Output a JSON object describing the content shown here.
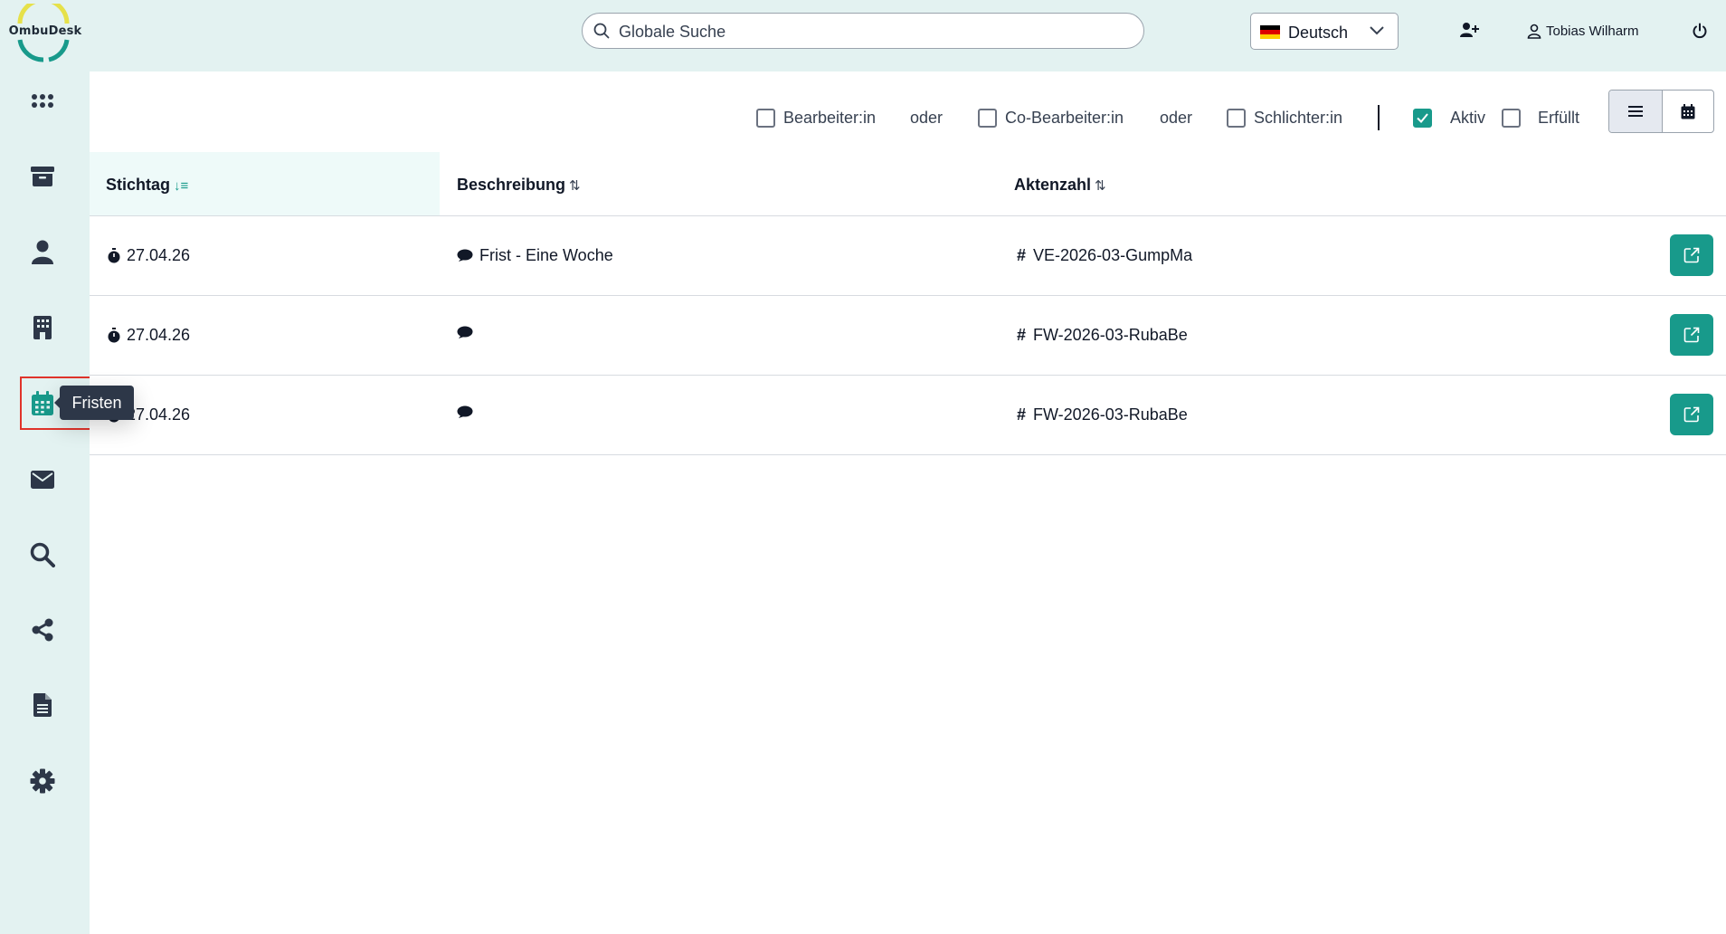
{
  "app": {
    "logo_text": "OmbuDesk"
  },
  "header": {
    "search_placeholder": "Globale Suche",
    "language": "Deutsch",
    "user_name": "Tobias Wilharm"
  },
  "sidebar": {
    "items": [
      {
        "icon": "grid-icon"
      },
      {
        "icon": "archive-icon"
      },
      {
        "icon": "user-icon"
      },
      {
        "icon": "building-icon"
      },
      {
        "icon": "calendar-icon",
        "active": true
      },
      {
        "icon": "envelope-icon"
      },
      {
        "icon": "search-icon"
      },
      {
        "icon": "share-icon"
      },
      {
        "icon": "document-icon"
      },
      {
        "icon": "gear-icon"
      }
    ],
    "tooltip": "Fristen"
  },
  "filters": {
    "bearbeiter": "Bearbeiter:in",
    "or1": "oder",
    "co_bearbeiter": "Co-Bearbeiter:in",
    "or2": "oder",
    "schlichter": "Schlichter:in",
    "aktiv": "Aktiv",
    "erfuellt": "Erfüllt"
  },
  "table": {
    "headers": {
      "stichtag": "Stichtag",
      "beschreibung": "Beschreibung",
      "aktenzahl": "Aktenzahl"
    },
    "rows": [
      {
        "date": "27.04.26",
        "description": "Frist - Eine Woche",
        "case": "VE-2026-03-GumpMa"
      },
      {
        "date": "27.04.26",
        "description": "",
        "case": "FW-2026-03-RubaBe"
      },
      {
        "date": "27.04.26",
        "description": "",
        "case": "FW-2026-03-RubaBe"
      }
    ]
  },
  "colors": {
    "accent": "#189a8b",
    "sidebar_bg": "#e3f2f1",
    "highlight": "#e0342b"
  }
}
